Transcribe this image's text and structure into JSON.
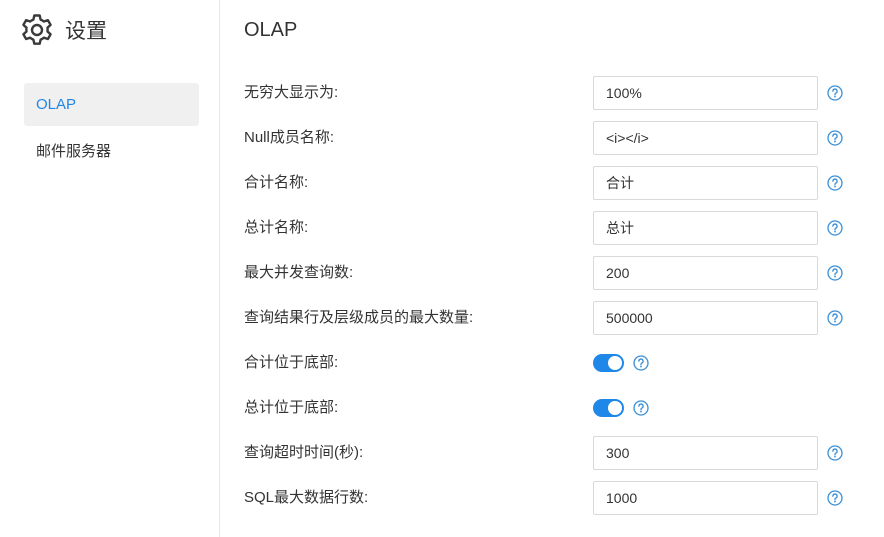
{
  "app": {
    "title": "设置"
  },
  "sidebar": {
    "items": [
      {
        "label": "OLAP",
        "active": true
      },
      {
        "label": "邮件服务器",
        "active": false
      }
    ]
  },
  "main": {
    "title": "OLAP",
    "fields": [
      {
        "label": "无穷大显示为:",
        "type": "input",
        "value": "100%"
      },
      {
        "label": "Null成员名称:",
        "type": "input",
        "value": "<i></i>"
      },
      {
        "label": "合计名称:",
        "type": "input",
        "value": "合计"
      },
      {
        "label": "总计名称:",
        "type": "input",
        "value": "总计"
      },
      {
        "label": "最大并发查询数:",
        "type": "input",
        "value": "200"
      },
      {
        "label": "查询结果行及层级成员的最大数量:",
        "type": "input",
        "value": "500000"
      },
      {
        "label": "合计位于底部:",
        "type": "switch",
        "checked": true
      },
      {
        "label": "总计位于底部:",
        "type": "switch",
        "checked": true
      },
      {
        "label": "查询超时时间(秒):",
        "type": "input",
        "value": "300"
      },
      {
        "label": "SQL最大数据行数:",
        "type": "input",
        "value": "1000"
      }
    ]
  },
  "icons": {
    "brand": "gear-icon",
    "help": "help-circle-icon"
  },
  "colors": {
    "accent": "#1f87e8",
    "active_nav_bg": "#f0f0f0",
    "help_icon": "#3a8fd6"
  }
}
